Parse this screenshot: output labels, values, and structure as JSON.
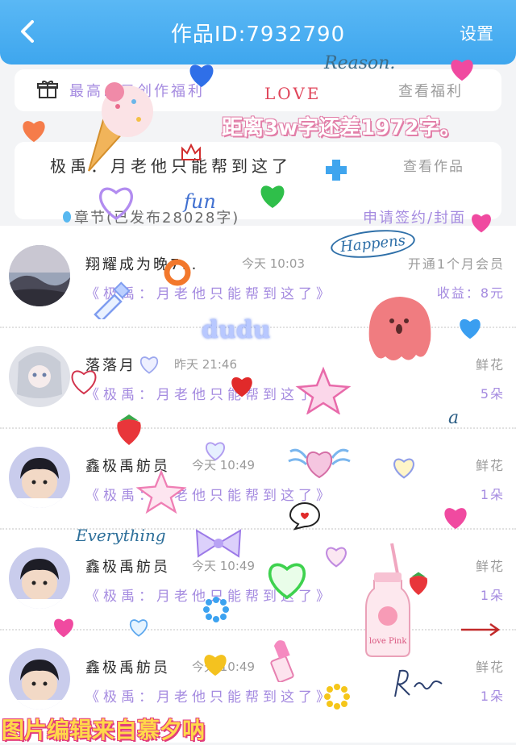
{
  "header": {
    "title": "作品ID:7932790",
    "settings_label": "设置"
  },
  "welfare": {
    "text": "最高…元创作福利",
    "link": "查看福利"
  },
  "book": {
    "title": "极禹：月老他只能帮到这了",
    "view_link": "查看作品",
    "chapter_label": "章节(已发布28028字)",
    "apply_link": "申请签约/封面"
  },
  "entries": [
    {
      "name": "翔耀成为晚7…",
      "time": "今天 10:03",
      "book": "《极禹：月老他只能帮到这了》",
      "right_label": "开通1个月会员",
      "right_value": "收益：8元"
    },
    {
      "name": "落落月",
      "time": "昨天 21:46",
      "book": "《极禹：月老他只能帮到这了》",
      "right_label": "鲜花",
      "right_value": "5朵"
    },
    {
      "name": "鑫极禹舫员",
      "time": "今天 10:49",
      "book": "《极禹：月老他只能帮到这了》",
      "right_label": "鲜花",
      "right_value": "1朵"
    },
    {
      "name": "鑫极禹舫员",
      "time": "今天 10:49",
      "book": "《极禹：月老他只能帮到这了》",
      "right_label": "鲜花",
      "right_value": "1朵"
    },
    {
      "name": "鑫极禹舫员",
      "time": "今天 10:49",
      "book": "《极禹：月老他只能帮到这了》",
      "right_label": "鲜花",
      "right_value": "1朵"
    }
  ],
  "stickers": {
    "caption": "距离3w字还差1972字。",
    "footer": "图片编辑来自慕夕呐",
    "love": "LOVE",
    "reason": "Reason.",
    "fun": "fun",
    "happens": "Happens",
    "dudu": "dudu",
    "everything": "Everything",
    "letter_a": "a",
    "bottle": "love Pink"
  }
}
